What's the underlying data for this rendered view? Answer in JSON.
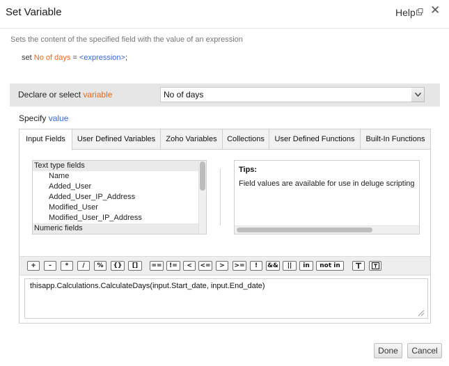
{
  "dialog": {
    "title": "Set Variable",
    "help_label": "Help",
    "close_glyph": "✕",
    "description": "Sets the content of the specified field with the value of an expression"
  },
  "statement": {
    "keyword": "set",
    "variable": "No of days",
    "equals": "=",
    "expression": "<expression>",
    "terminator": ";"
  },
  "declare": {
    "label_prefix": "Declare or select",
    "label_highlight": "variable",
    "selected_value": "No of days"
  },
  "specify": {
    "label_prefix": "Specify",
    "label_highlight": "value"
  },
  "tabs": [
    {
      "label": "Input Fields",
      "active": true
    },
    {
      "label": "User Defined Variables",
      "active": false
    },
    {
      "label": "Zoho Variables",
      "active": false
    },
    {
      "label": "Collections",
      "active": false
    },
    {
      "label": "User Defined Functions",
      "active": false
    },
    {
      "label": "Built-In Functions",
      "active": false
    }
  ],
  "field_list": {
    "rows": [
      {
        "label": "Text type fields",
        "type": "group"
      },
      {
        "label": "Name",
        "type": "item"
      },
      {
        "label": "Added_User",
        "type": "item"
      },
      {
        "label": "Added_User_IP_Address",
        "type": "item"
      },
      {
        "label": "Modified_User",
        "type": "item"
      },
      {
        "label": "Modified_User_IP_Address",
        "type": "item"
      },
      {
        "label": "Numeric fields",
        "type": "group"
      }
    ]
  },
  "tips": {
    "title": "Tips:",
    "text": "Field values are available for use in deluge scripting"
  },
  "operators": [
    "+",
    "-",
    "*",
    "/",
    "%",
    "{}",
    "[]",
    "==",
    "!=",
    "<",
    "<=",
    ">",
    ">=",
    "!",
    "&&",
    "||",
    "in",
    "not in",
    "T",
    "T-box"
  ],
  "expression": {
    "value": "thisapp.Calculations.CalculateDays(input.Start_date, input.End_date)"
  },
  "buttons": {
    "done": "Done",
    "cancel": "Cancel"
  },
  "colors": {
    "highlight_orange": "#e8681c",
    "highlight_blue": "#3b6ad6"
  }
}
